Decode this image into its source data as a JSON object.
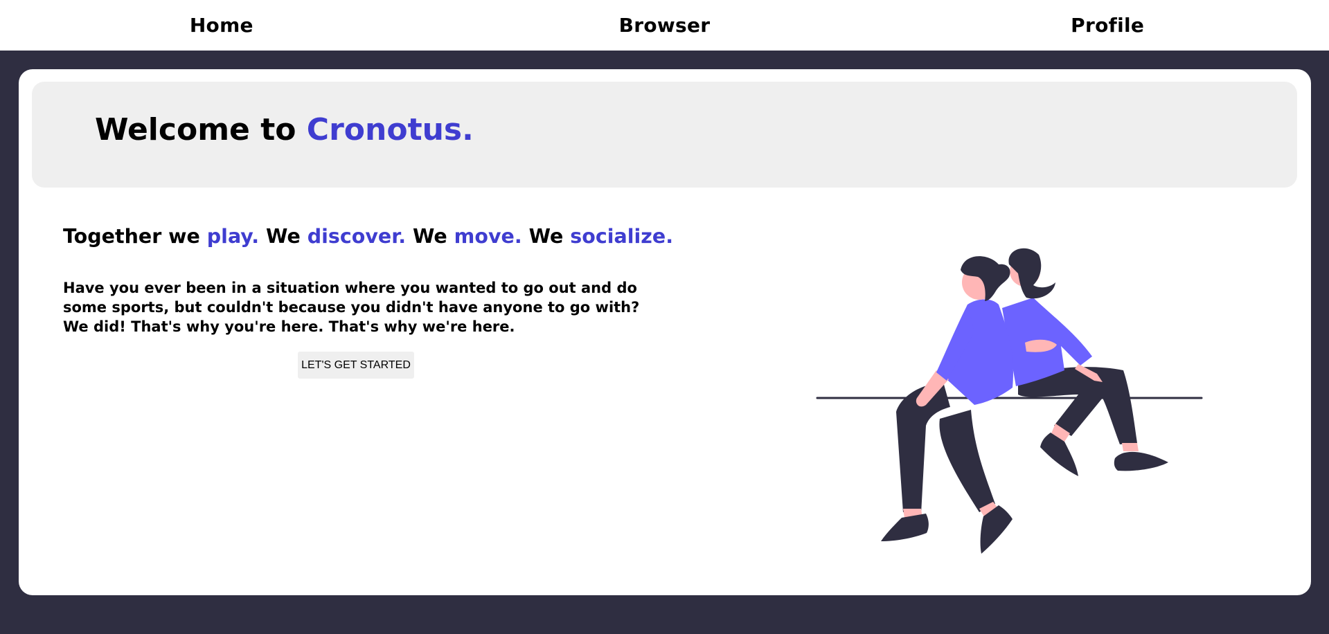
{
  "nav": {
    "items": [
      {
        "label": "Home"
      },
      {
        "label": "Browser"
      },
      {
        "label": "Profile"
      }
    ]
  },
  "hero": {
    "title_prefix": "Welcome to ",
    "title_brand": "Cronotus."
  },
  "tagline": {
    "parts": [
      {
        "text": "Together we ",
        "accent": false
      },
      {
        "text": "play.",
        "accent": true
      },
      {
        "text": " We ",
        "accent": false
      },
      {
        "text": "discover.",
        "accent": true
      },
      {
        "text": " We ",
        "accent": false
      },
      {
        "text": "move.",
        "accent": true
      },
      {
        "text": " We ",
        "accent": false
      },
      {
        "text": "socialize.",
        "accent": true
      }
    ]
  },
  "intro": {
    "text": "Have you ever been in a situation where you wanted to go out and do some sports, but couldn't because you didn't have anyone to go with? We did! That's why you're here. That's why we're here."
  },
  "cta": {
    "label": "LET'S GET STARTED"
  },
  "illustration": {
    "icon": "two-people-sitting-illustration"
  },
  "colors": {
    "accent": "#3f3dd0",
    "shirt": "#6c63ff",
    "dark": "#2f2e41",
    "skin": "#ffb6b6",
    "hero_bg": "#efefef",
    "page_bg": "#2f2e41"
  }
}
